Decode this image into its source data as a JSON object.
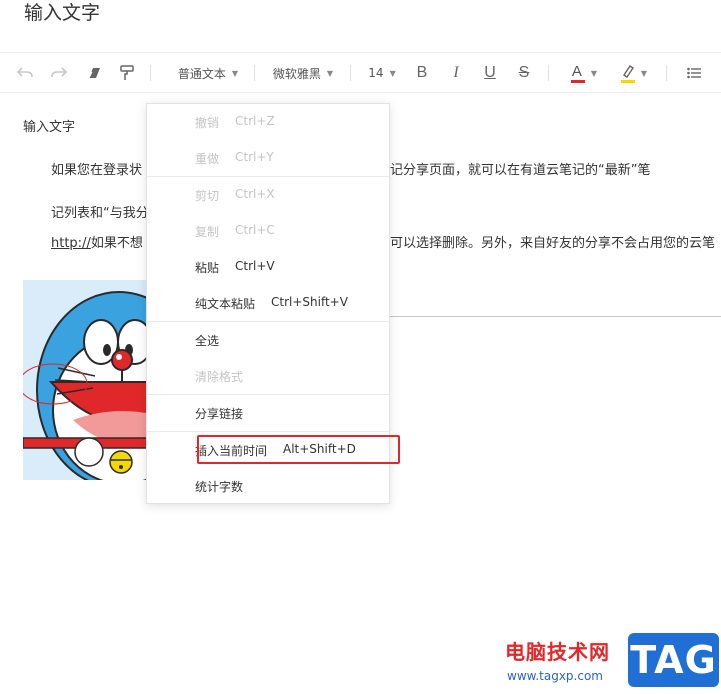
{
  "document": {
    "title": "输入文字"
  },
  "toolbar": {
    "paragraph_style": "普通文本",
    "font_family": "微软雅黑",
    "font_size": "14",
    "bold": "B",
    "italic": "I",
    "underline": "U",
    "strikethrough": "S",
    "font_color": "A"
  },
  "content": {
    "heading": "输入文字",
    "line1_start": "如果您在登录状",
    "line1_end": "记分享页面，就可以在有道云笔记的“最新”笔",
    "line2_start": "记列表和“与我分",
    "line3_link": "http://",
    "line3_start": "如果不想",
    "line3_end": "可以选择删除。另外，来自好友的分享不会占用您的云笔"
  },
  "context_menu": {
    "items": [
      {
        "label": "撤销",
        "shortcut": "Ctrl+Z",
        "disabled": true
      },
      {
        "label": "重做",
        "shortcut": "Ctrl+Y",
        "disabled": true
      },
      {
        "label": "剪切",
        "shortcut": "Ctrl+X",
        "disabled": true
      },
      {
        "label": "复制",
        "shortcut": "Ctrl+C",
        "disabled": true
      },
      {
        "label": "粘贴",
        "shortcut": "Ctrl+V",
        "disabled": false
      },
      {
        "label": "纯文本粘贴",
        "shortcut": "Ctrl+Shift+V",
        "disabled": false
      },
      {
        "label": "全选",
        "shortcut": "",
        "disabled": false
      },
      {
        "label": "清除格式",
        "shortcut": "",
        "disabled": true
      },
      {
        "label": "分享链接",
        "shortcut": "",
        "disabled": false
      },
      {
        "label": "插入当前时间",
        "shortcut": "Alt+Shift+D",
        "disabled": false
      },
      {
        "label": "统计字数",
        "shortcut": "",
        "disabled": false
      }
    ]
  },
  "watermark": {
    "site_name": "电脑技术网",
    "url": "www.tagxp.com",
    "tag": "TAG"
  },
  "colors": {
    "font_color_underline": "#e0282a",
    "highlight_underline": "#f5d800",
    "annotation_box": "#e0282a",
    "watermark_red": "#e52727",
    "watermark_blue": "#1f6fd4"
  }
}
